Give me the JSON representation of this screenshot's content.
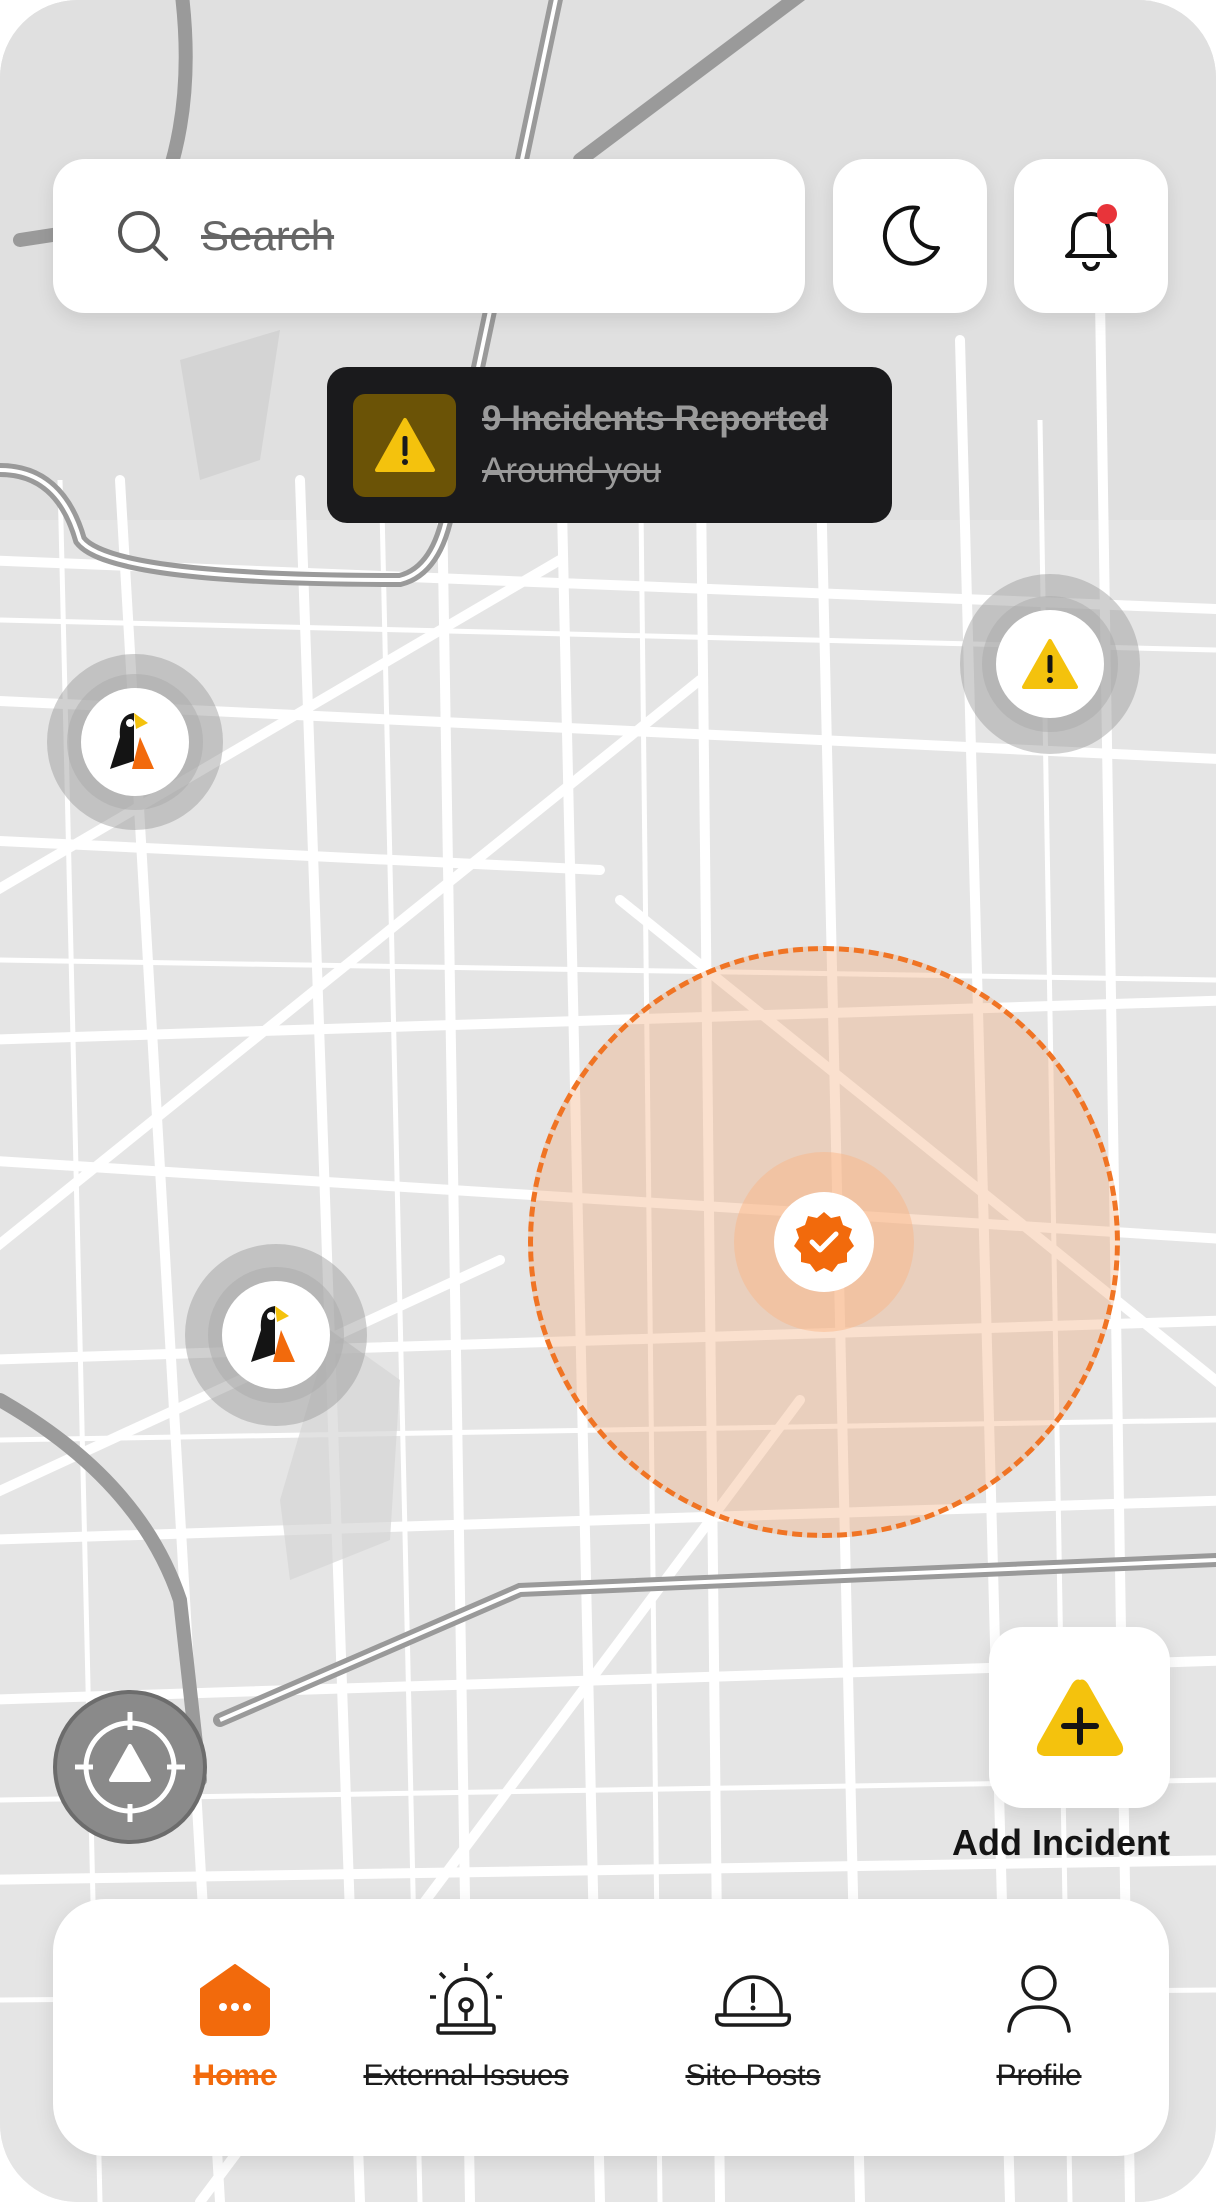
{
  "search": {
    "placeholder": "Search",
    "icon": "search-icon"
  },
  "header_buttons": [
    {
      "name": "dark-mode-button",
      "icon": "moon-icon"
    },
    {
      "name": "notifications-button",
      "icon": "bell-icon",
      "has_badge": true
    }
  ],
  "incident_toast": {
    "icon": "warning-icon",
    "title": "9 Incidents Reported",
    "subtitle": "Around you"
  },
  "map_markers": [
    {
      "name": "user-marker-1",
      "icon": "bird-avatar-icon"
    },
    {
      "name": "user-marker-2",
      "icon": "bird-avatar-icon"
    },
    {
      "name": "incident-marker",
      "icon": "warning-icon"
    },
    {
      "name": "verified-zone-marker",
      "icon": "verified-badge-icon"
    }
  ],
  "recenter_button": {
    "icon": "navigation-arrow-icon"
  },
  "add_incident": {
    "label": "Add Incident",
    "icon": "add-triangle-icon"
  },
  "nav": {
    "items": [
      {
        "label": "Home",
        "icon": "home-icon",
        "active": true
      },
      {
        "label": "External Issues",
        "icon": "siren-icon",
        "active": false
      },
      {
        "label": "Site Posts",
        "icon": "hard-hat-icon",
        "active": false
      },
      {
        "label": "Profile",
        "icon": "user-icon",
        "active": false
      }
    ]
  },
  "colors": {
    "accent": "#F26A0C",
    "warning": "#F4C20D",
    "notification_dot": "#E8343A",
    "toast_bg": "#1A1A1C",
    "map_bg": "#E6E6E6"
  }
}
